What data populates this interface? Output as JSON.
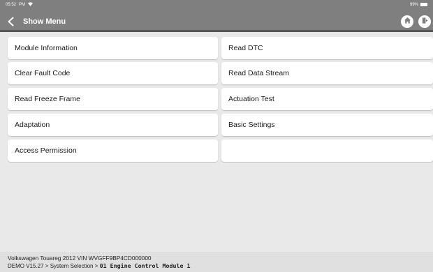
{
  "status_bar": {
    "time": "05:52",
    "ampm": "PM",
    "battery": "99%",
    "wifi_icon": "wifi-icon",
    "battery_icon": "battery-icon"
  },
  "header": {
    "title": "Show Menu",
    "back_icon": "chevron-left-icon",
    "home_icon": "home-icon",
    "exit_icon": "exit-icon",
    "background_color": "#7f7f7f"
  },
  "menu": {
    "left": [
      {
        "label": "Module Information"
      },
      {
        "label": "Clear Fault Code"
      },
      {
        "label": "Read Freeze Frame"
      },
      {
        "label": "Adaptation"
      },
      {
        "label": "Access Permission"
      }
    ],
    "right": [
      {
        "label": "Read DTC"
      },
      {
        "label": "Read Data Stream"
      },
      {
        "label": "Actuation Test"
      },
      {
        "label": "Basic Settings"
      },
      {
        "label": ""
      }
    ]
  },
  "footer": {
    "vehicle_line": "Volkswagen  Touareg  2012  VIN  WVGFF9BP4CD000000",
    "path_prefix": "DEMO V15.27 > System Selection > ",
    "path_module": "01 Engine Control Module 1"
  }
}
